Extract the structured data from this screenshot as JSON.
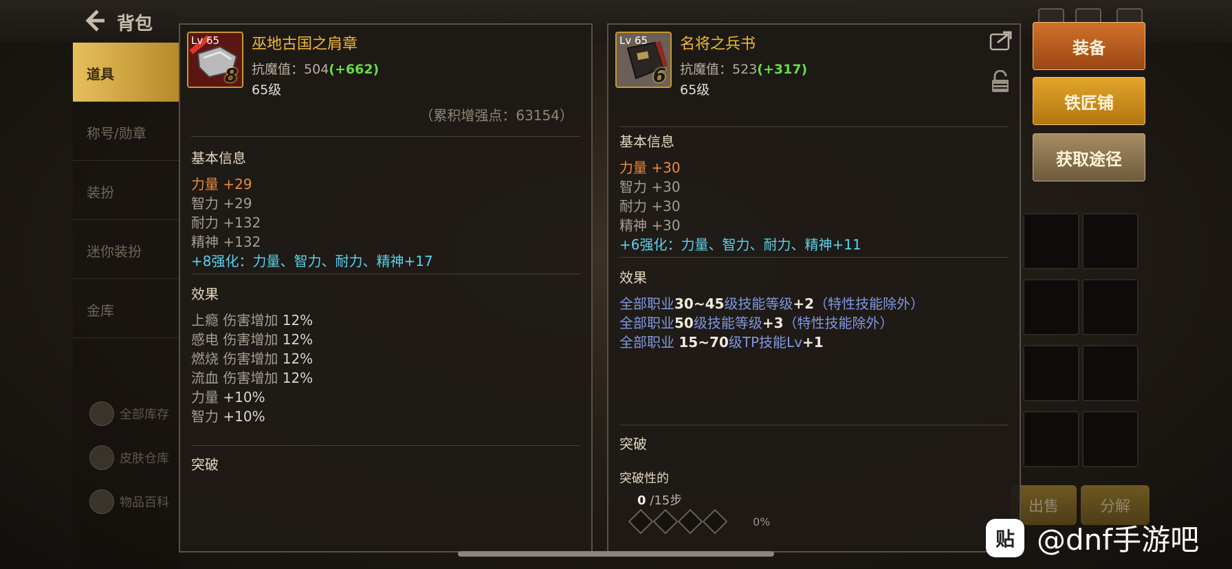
{
  "background": {
    "title": "背包",
    "nav_items": [
      "道具",
      "称号/勋章",
      "装扮",
      "迷你装扮",
      "金库"
    ],
    "nav_bottom": [
      "全部库存",
      "皮肤仓库",
      "物品百科"
    ],
    "bottom_buttons": [
      "出售",
      "分解"
    ]
  },
  "left_item": {
    "icon_level": "Lv 65",
    "icon_enhance": "8",
    "name": "巫地古国之肩章",
    "resist_label": "抗魔值：",
    "resist_value": "504",
    "resist_bonus": "(+662)",
    "level": "65级",
    "accumulated": "（累积增强点：63154）",
    "basic_info_title": "基本信息",
    "stats": {
      "str": "力量 +29",
      "int_label": "智力 ",
      "int_val": "+29",
      "vit_label": "耐力 ",
      "vit_val": "+132",
      "spi_label": "精神 ",
      "spi_val": "+132",
      "enhance": "+8强化：力量、智力、耐力、精神+17"
    },
    "effects_title": "效果",
    "effects": [
      {
        "label": "上瘾 伤害增加 ",
        "value": "12%"
      },
      {
        "label": "感电 伤害增加 ",
        "value": "12%"
      },
      {
        "label": "燃烧 伤害增加 ",
        "value": "12%"
      },
      {
        "label": "流血 伤害增加 ",
        "value": "12%"
      },
      {
        "label": "力量 ",
        "value": "+10%"
      },
      {
        "label": "智力 ",
        "value": "+10%"
      }
    ],
    "breakthrough_title": "突破"
  },
  "right_item": {
    "icon_level": "Lv 65",
    "icon_enhance": "6",
    "name": "名将之兵书",
    "resist_label": "抗魔值：",
    "resist_value": "523",
    "resist_bonus": "(+317)",
    "level": "65级",
    "basic_info_title": "基本信息",
    "stats": {
      "str": "力量 +30",
      "int_label": "智力 ",
      "int_val": "+30",
      "vit_label": "耐力 ",
      "vit_val": "+30",
      "spi_label": "精神 ",
      "spi_val": "+30",
      "enhance": "+6强化：力量、智力、耐力、精神+11"
    },
    "effects_title": "效果",
    "effects": [
      {
        "a": "全部职业",
        "b": "30~45",
        "c": "级技能等级",
        "d": "+2",
        "e": "（特性技能除外）"
      },
      {
        "a": "全部职业",
        "b": "50",
        "c": "级技能等级",
        "d": "+3",
        "e": "（特性技能除外）"
      },
      {
        "a": "全部职业 ",
        "b": "15~70",
        "c": "级TP技能Lv",
        "d": "+1",
        "e": ""
      }
    ],
    "breakthrough_title": "突破",
    "breakthrough_sub": "突破性的",
    "steps_current": "0",
    "steps_total": "/15步",
    "breakthrough_progress": 0,
    "progress_pct": "0%"
  },
  "actions": {
    "equip": "装备",
    "blacksmith": "铁匠铺",
    "source": "获取途径"
  },
  "watermark": {
    "logo": "贴",
    "text": "@dnf手游吧"
  },
  "colors": {
    "gold": "#f0b833",
    "green_bonus": "#66dd44",
    "strength_orange": "#ee8a3c",
    "enhance_cyan": "#5ad3ee",
    "effect_blue": "#7f98e0"
  }
}
